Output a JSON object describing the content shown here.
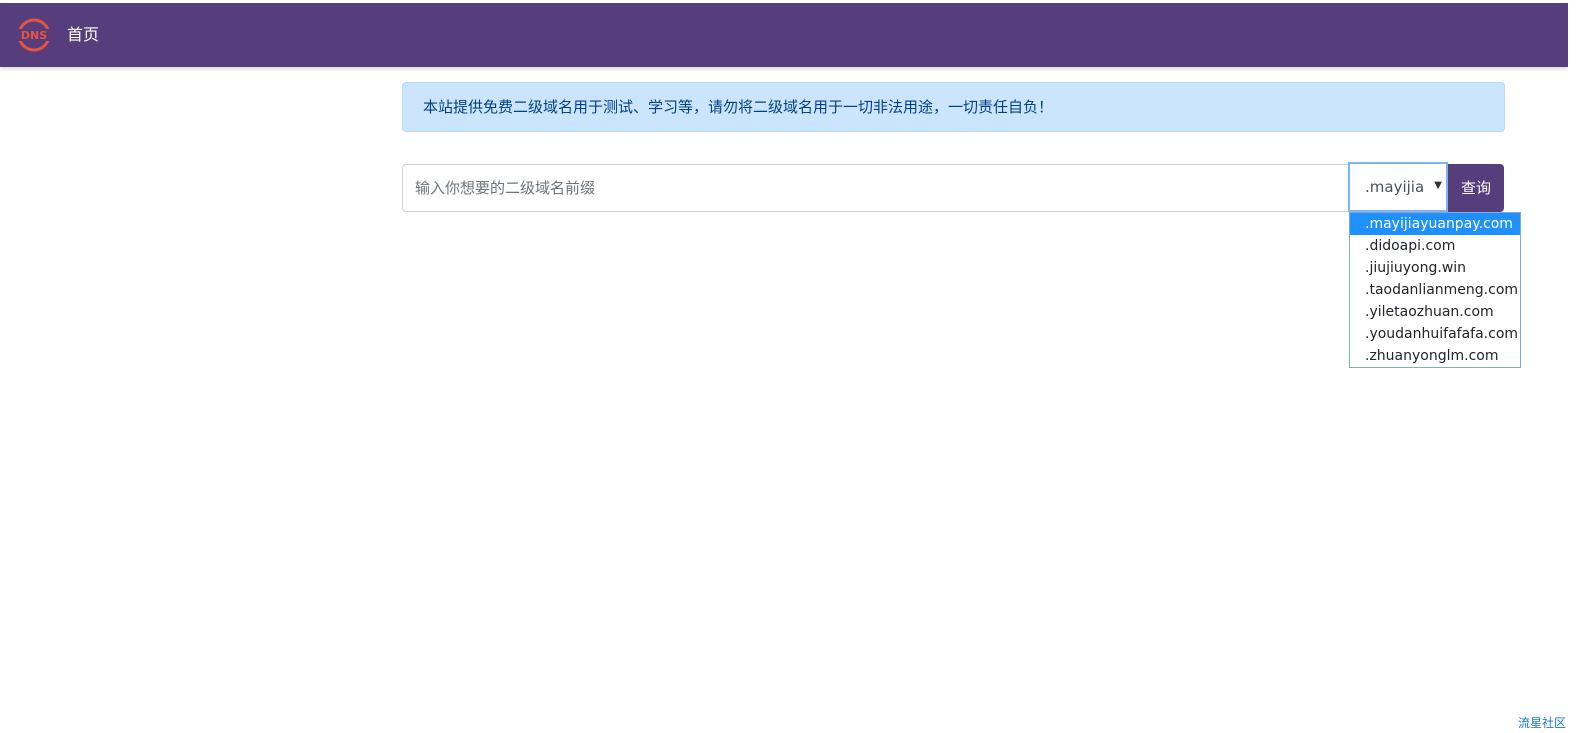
{
  "navbar": {
    "logo_icon": "dns-globe-icon",
    "logo_text": "DNS",
    "brand": "首页",
    "background": "#563d7c",
    "logo_color": "#e8533c"
  },
  "alert": {
    "text": "本站提供免费二级域名用于测试、学习等，请勿将二级域名用于一切非法用途，一切责任自负！",
    "background": "#cce5ff"
  },
  "search": {
    "placeholder": "输入你想要的二级域名前缀",
    "value": "",
    "selected_suffix": ".mayijia",
    "arrow_icon": "caret-down-icon",
    "button_label": "查询"
  },
  "dropdown": {
    "options": [
      ".mayijiayuanpay.com",
      ".didoapi.com",
      ".jiujiuyong.win",
      ".taodanlianmeng.com",
      ".yiletaozhuan.com",
      ".youdanhuifafafa.com",
      ".zhuanyonglm.com"
    ],
    "highlight_color": "#1e90ff"
  },
  "footer": {
    "link_text": "流星社区"
  }
}
